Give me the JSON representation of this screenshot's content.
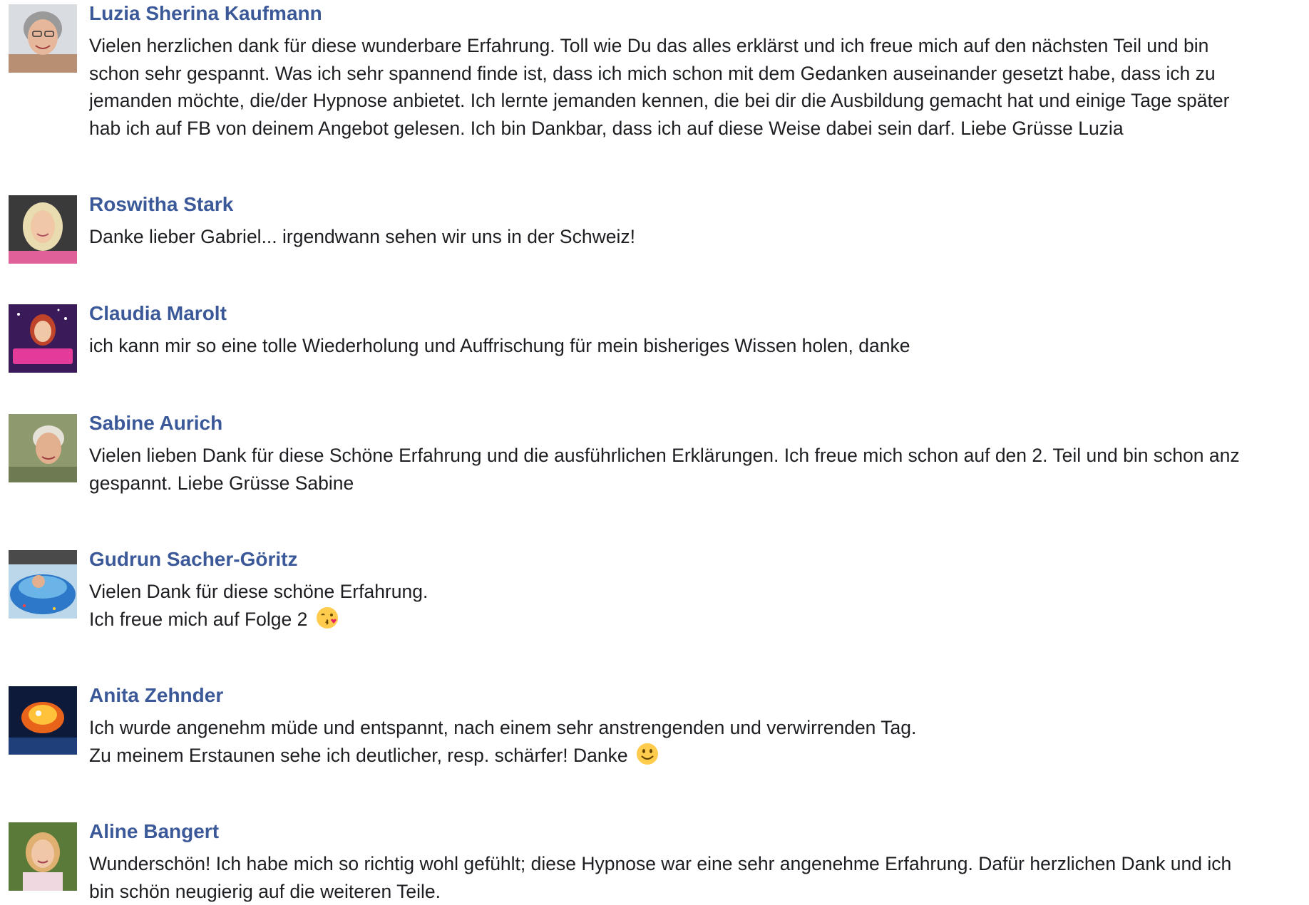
{
  "comments": [
    {
      "author": "Luzia Sherina Kaufmann",
      "lines": [
        "Vielen herzlichen dank für diese wunderbare Erfahrung. Toll wie Du das alles erklärst und ich freue mich auf den nächsten Teil und bin",
        "schon sehr gespannt. Was ich sehr spannend finde ist, dass ich mich schon mit dem Gedanken auseinander gesetzt habe, dass ich zu",
        "jemanden möchte, die/der Hypnose anbietet. Ich lernte jemanden kennen, die bei dir die Ausbildung gemacht hat und einige Tage später",
        "hab ich auf FB von deinem Angebot gelesen. Ich bin Dankbar, dass ich auf diese Weise dabei sein darf. Liebe Grüsse Luzia"
      ]
    },
    {
      "author": "Roswitha Stark",
      "lines": [
        "Danke lieber Gabriel... irgendwann sehen wir uns in der Schweiz!"
      ]
    },
    {
      "author": "Claudia Marolt",
      "lines": [
        "ich kann mir so eine tolle Wiederholung und Auffrischung für mein bisheriges Wissen holen, danke"
      ]
    },
    {
      "author": "Sabine Aurich",
      "lines": [
        "Vielen lieben Dank für diese Schöne Erfahrung und die ausführlichen Erklärungen. Ich freue mich schon auf den 2. Teil und bin schon anz",
        "gespannt. Liebe Grüsse Sabine"
      ]
    },
    {
      "author": "Gudrun Sacher-Göritz",
      "lines": [
        "Vielen Dank für diese schöne Erfahrung.",
        "Ich freue mich auf Folge 2"
      ],
      "emoji": "kiss-emoji"
    },
    {
      "author": "Anita Zehnder",
      "lines": [
        "Ich wurde angenehm müde und entspannt, nach einem sehr anstrengenden und verwirrenden Tag.",
        "Zu meinem Erstaunen sehe ich deutlicher, resp. schärfer! Danke"
      ],
      "emoji": "smile-emoji"
    },
    {
      "author": "Aline Bangert",
      "lines": [
        "Wunderschön! Ich habe mich so richtig wohl gefühlt; diese Hypnose war eine sehr angenehme Erfahrung. Dafür herzlichen Dank und ich",
        "bin schön neugierig auf die weiteren Teile."
      ]
    }
  ],
  "colors": {
    "author_name": "#3b5998",
    "comment_text": "#1c1e21",
    "background": "#ffffff"
  }
}
